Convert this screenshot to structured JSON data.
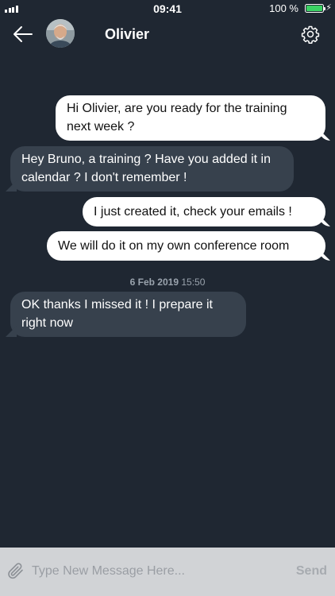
{
  "status_bar": {
    "time": "09:41",
    "battery_percent": "100 %",
    "battery_level": 1.0,
    "icons": [
      "signal-icon",
      "battery-icon",
      "charging-icon"
    ]
  },
  "header": {
    "contact_name": "Olivier",
    "back_icon": "arrow-left-icon",
    "settings_icon": "gear-icon"
  },
  "messages": [
    {
      "direction": "out",
      "text": "Hi Olivier, are you ready for the training next week ?"
    },
    {
      "direction": "in",
      "text": "Hey Bruno, a training ? Have you added it in calendar ? I don't remember !"
    },
    {
      "direction": "out",
      "text": "I just created it, check your emails !"
    },
    {
      "direction": "out",
      "text": "We will do it on my own conference room"
    },
    {
      "direction": "in",
      "text": "OK thanks I missed it ! I prepare it right now"
    }
  ],
  "date_separator": {
    "date": "6 Feb 2019",
    "time": "15:50"
  },
  "composer": {
    "placeholder": "Type New Message Here...",
    "value": "",
    "send_label": "Send",
    "attach_icon": "paperclip-icon"
  },
  "colors": {
    "background": "#1f2732",
    "incoming_bubble": "#37414d",
    "outgoing_bubble": "#ffffff",
    "composer_bar": "#d1d3d6",
    "battery": "#3bd264"
  }
}
